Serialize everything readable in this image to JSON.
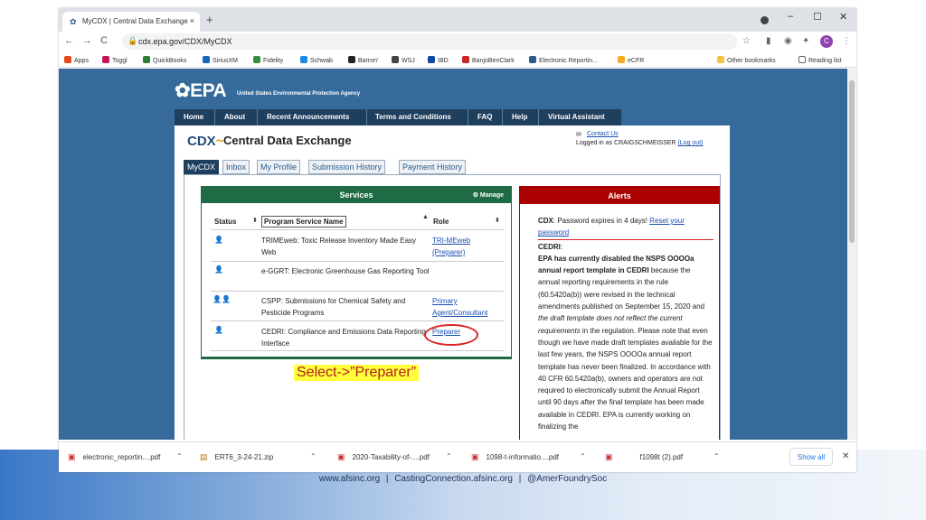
{
  "browser": {
    "tab_title": "MyCDX | Central Data Exchange",
    "tab_close": "×",
    "new_tab": "+",
    "window_controls": [
      "–",
      "☐",
      "✕"
    ],
    "nav": {
      "back": "←",
      "forward": "→",
      "reload": "C"
    },
    "url": "cdx.epa.gov/CDX/MyCDX",
    "avatar_letter": "C",
    "bookmarks": [
      {
        "label": "Apps",
        "color": "#e64a19"
      },
      {
        "label": "Toggl",
        "color": "#c2185b"
      },
      {
        "label": "QuickBooks",
        "color": "#2e7d32"
      },
      {
        "label": "SiriusXM",
        "color": "#1565c0"
      },
      {
        "label": "Fidelity",
        "color": "#388e3c"
      },
      {
        "label": "Schwab",
        "color": "#1e88e5"
      },
      {
        "label": "Barron'",
        "color": "#222222"
      },
      {
        "label": "WSJ",
        "color": "#444444"
      },
      {
        "label": "IBD",
        "color": "#0d47a1"
      },
      {
        "label": "BanjoBenClark",
        "color": "#c62828"
      },
      {
        "label": "Electronic Reportin...",
        "color": "#2a5a8a"
      },
      {
        "label": "eCFR",
        "color": "#f9a825"
      }
    ],
    "other_bookmarks": "Other bookmarks",
    "reading_list": "Reading list"
  },
  "page": {
    "epa_logo": "✿EPA",
    "epa_sub": "United States Environmental Protection Agency",
    "nav": [
      "Home",
      "About",
      "Recent Announcements",
      "Terms and Conditions",
      "FAQ",
      "Help",
      "Virtual Assistant"
    ],
    "cdx_logo": "CDX",
    "cdx_swoosh": "~",
    "title": "Central Data Exchange",
    "contact": "Contact Us",
    "logged_in": "Logged in as CRAIGSCHMEISSER",
    "logout": "(Log out)",
    "tabs": [
      "MyCDX",
      "Inbox",
      "My Profile",
      "Submission History",
      "Payment History"
    ],
    "services": {
      "header": "Services",
      "manage": "⚙ Manage",
      "columns": {
        "status": "Status",
        "name": "Program Service Name",
        "role": "Role"
      },
      "rows": [
        {
          "status_icon": "👤",
          "name": "TRIMEweb: Toxic Release Inventory Made Easy Web",
          "role": "TRI-MEweb (Preparer)"
        },
        {
          "status_icon": "👤",
          "name": "e-GGRT: Electronic Greenhouse Gas Reporting Tool",
          "role": ""
        },
        {
          "status_icon": "👤👤",
          "name": "CSPP: Submissions for Chemical Safety and Pesticide Programs",
          "role": "Primary Agent/Consultant"
        },
        {
          "status_icon": "👤",
          "name": "CEDRI: Compliance and Emissions Data Reporting Interface",
          "role": "Preparer"
        }
      ]
    },
    "alerts": {
      "header": "Alerts",
      "cdx_label": "CDX",
      "cdx_text": ": Password expires in 4 days! ",
      "cdx_link": "Reset your password",
      "cedri_label": "CEDRI",
      "bold_text": "EPA has currently disabled the NSPS OOOOa annual report template in CEDRI",
      "text_1": " because the annual reporting requirements in the rule (60.5420a(b)) were revised in the technical amendments published on September 15, 2020 and ",
      "italic_text": "the draft template does not reflect the current requirements",
      "text_2": " in the regulation. Please note that even though we have made draft templates available for the last few years, the NSPS OOOOa annual report template has never been finalized. In accordance with 40 CFR 60.5420a(b), owners and operators are not required to electronically submit the Annual Report until 90 days after the final template has been made available in CEDRI. EPA is currently working on finalizing the"
    }
  },
  "annotation": {
    "callout": "Select->”Preparer”"
  },
  "downloads": {
    "items": [
      "electronic_reportin....pdf",
      "ERT6_3-24-21.zip",
      "2020-Taxability-of-....pdf",
      "1098-t-informatio....pdf",
      "f1098t (2).pdf"
    ],
    "show_all": "Show all",
    "close": "✕"
  },
  "footer": {
    "site": "www.afsinc.org",
    "casting": "CastingConnection.afsinc.org",
    "social": "@AmerFoundrySoc"
  }
}
